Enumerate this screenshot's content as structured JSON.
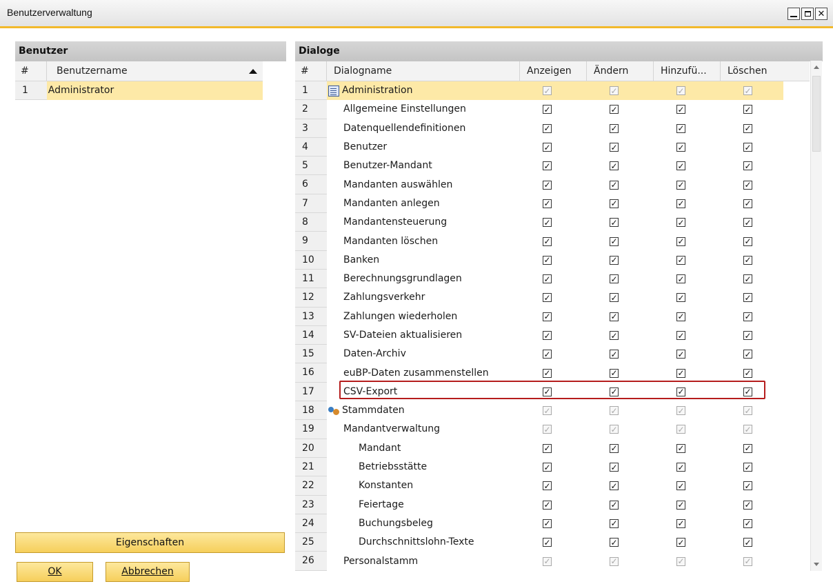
{
  "window": {
    "title": "Benutzerverwaltung"
  },
  "users_panel": {
    "title": "Benutzer",
    "columns": {
      "num": "#",
      "name": "Benutzername"
    },
    "rows": [
      {
        "num": "1",
        "name": "Administrator"
      }
    ]
  },
  "buttons": {
    "properties": "Eigenschaften",
    "ok": "OK",
    "cancel": "Abbrechen"
  },
  "dialogs_panel": {
    "title": "Dialoge",
    "columns": {
      "num": "#",
      "name": "Dialogname",
      "show": "Anzeigen",
      "change": "Ändern",
      "add": "Hinzufü...",
      "delete": "Löschen"
    },
    "rows": [
      {
        "num": "1",
        "name": "Administration",
        "level": 0,
        "icon": "document-icon",
        "disabled": true,
        "selected": true
      },
      {
        "num": "2",
        "name": "Allgemeine Einstellungen",
        "level": 1,
        "disabled": false
      },
      {
        "num": "3",
        "name": "Datenquellendefinitionen",
        "level": 1,
        "disabled": false
      },
      {
        "num": "4",
        "name": "Benutzer",
        "level": 1,
        "disabled": false
      },
      {
        "num": "5",
        "name": "Benutzer-Mandant",
        "level": 1,
        "disabled": false
      },
      {
        "num": "6",
        "name": "Mandanten auswählen",
        "level": 1,
        "disabled": false
      },
      {
        "num": "7",
        "name": "Mandanten anlegen",
        "level": 1,
        "disabled": false
      },
      {
        "num": "8",
        "name": "Mandantensteuerung",
        "level": 1,
        "disabled": false
      },
      {
        "num": "9",
        "name": "Mandanten löschen",
        "level": 1,
        "disabled": false
      },
      {
        "num": "10",
        "name": "Banken",
        "level": 1,
        "disabled": false
      },
      {
        "num": "11",
        "name": "Berechnungsgrundlagen",
        "level": 1,
        "disabled": false
      },
      {
        "num": "12",
        "name": "Zahlungsverkehr",
        "level": 1,
        "disabled": false
      },
      {
        "num": "13",
        "name": "Zahlungen wiederholen",
        "level": 1,
        "disabled": false
      },
      {
        "num": "14",
        "name": "SV-Dateien aktualisieren",
        "level": 1,
        "disabled": false
      },
      {
        "num": "15",
        "name": "Daten-Archiv",
        "level": 1,
        "disabled": false
      },
      {
        "num": "16",
        "name": "euBP-Daten zusammenstellen",
        "level": 1,
        "disabled": false
      },
      {
        "num": "17",
        "name": "CSV-Export",
        "level": 1,
        "disabled": false,
        "highlighted": true
      },
      {
        "num": "18",
        "name": "Stammdaten",
        "level": 0,
        "icon": "people-icon",
        "disabled": true
      },
      {
        "num": "19",
        "name": "Mandantverwaltung",
        "level": 1,
        "disabled": true
      },
      {
        "num": "20",
        "name": "Mandant",
        "level": 2,
        "disabled": false
      },
      {
        "num": "21",
        "name": "Betriebsstätte",
        "level": 2,
        "disabled": false
      },
      {
        "num": "22",
        "name": "Konstanten",
        "level": 2,
        "disabled": false
      },
      {
        "num": "23",
        "name": "Feiertage",
        "level": 2,
        "disabled": false
      },
      {
        "num": "24",
        "name": "Buchungsbeleg",
        "level": 2,
        "disabled": false
      },
      {
        "num": "25",
        "name": "Durchschnittslohn-Texte",
        "level": 2,
        "disabled": false
      },
      {
        "num": "26",
        "name": "Personalstamm",
        "level": 1,
        "disabled": true
      }
    ]
  },
  "colors": {
    "accent": "#f2b92b",
    "selection": "#fde9a7",
    "highlight_border": "#b51c1c"
  }
}
